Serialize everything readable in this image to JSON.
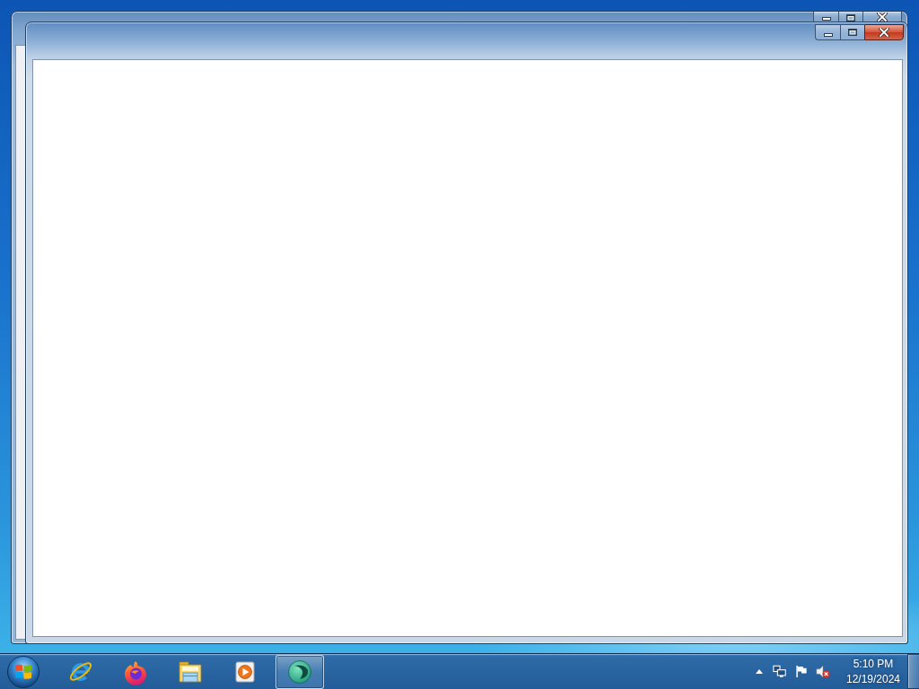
{
  "desktop": {
    "windows": [
      {
        "active": false
      },
      {
        "active": true
      }
    ]
  },
  "taskbar": {
    "items": [
      {
        "kind": "ebrowser",
        "selected": false
      },
      {
        "kind": "foxbrowser",
        "selected": false
      },
      {
        "kind": "folder",
        "selected": false
      },
      {
        "kind": "player",
        "selected": false
      },
      {
        "kind": "circleapp",
        "selected": true
      }
    ],
    "tray": {
      "muted": true
    },
    "clock": {
      "time": "5:10 PM",
      "date": "12/19/2024"
    }
  }
}
